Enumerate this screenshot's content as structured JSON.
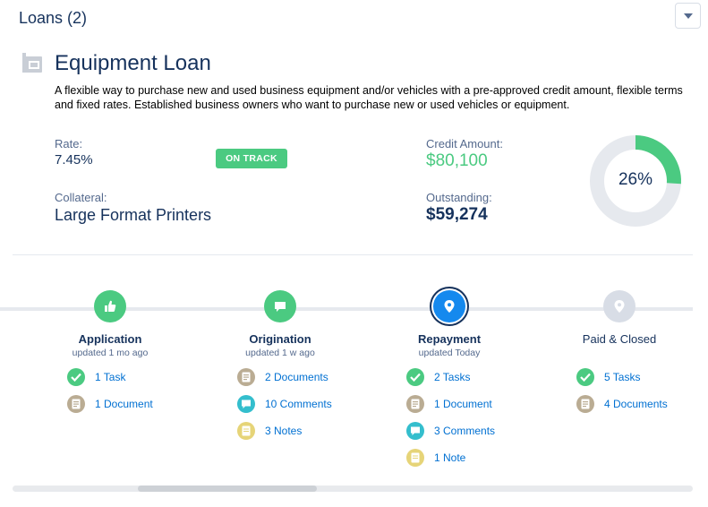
{
  "header": {
    "title": "Loans (2)",
    "menu_icon": "chevron-down-icon"
  },
  "loan": {
    "icon": "loan-building-icon",
    "title": "Equipment Loan",
    "description": "A flexible way to purchase new and used business equipment and/or vehicles with a pre-approved credit amount, flexible terms and fixed rates.  Established business owners who want to purchase new or used vehicles or equipment.",
    "rate_label": "Rate:",
    "rate_value": "7.45%",
    "status_badge": "ON TRACK",
    "collateral_label": "Collateral:",
    "collateral_value": "Large Format Printers",
    "credit_label": "Credit Amount:",
    "credit_value": "$80,100",
    "outstanding_label": "Outstanding:",
    "outstanding_value": "$59,274",
    "progress_text": "26%",
    "progress_fraction": 0.26
  },
  "stages": [
    {
      "name": "Application",
      "updated": "updated 1 mo ago",
      "state": "done",
      "icon": "thumbs-up-icon",
      "items": [
        {
          "icon": "check-icon",
          "label": "1 Task"
        },
        {
          "icon": "document-icon",
          "label": "1 Document"
        }
      ]
    },
    {
      "name": "Origination",
      "updated": "updated 1 w ago",
      "state": "done",
      "icon": "chat-bubble-icon",
      "items": [
        {
          "icon": "document-icon",
          "label": "2 Documents"
        },
        {
          "icon": "comment-icon",
          "label": "10 Comments"
        },
        {
          "icon": "note-icon",
          "label": "3 Notes"
        }
      ]
    },
    {
      "name": "Repayment",
      "updated": "updated Today",
      "state": "active",
      "icon": "location-pin-icon",
      "items": [
        {
          "icon": "check-icon",
          "label": "2 Tasks"
        },
        {
          "icon": "document-icon",
          "label": "1 Document"
        },
        {
          "icon": "comment-icon",
          "label": "3 Comments"
        },
        {
          "icon": "note-icon",
          "label": "1 Note"
        }
      ]
    },
    {
      "name": "Paid & Closed",
      "updated": "",
      "state": "pending",
      "icon": "location-pin-icon",
      "items": [
        {
          "icon": "check-icon",
          "label": "5 Tasks"
        },
        {
          "icon": "document-icon",
          "label": "4 Documents"
        }
      ]
    }
  ],
  "colors": {
    "accent_green": "#4bca81",
    "active_blue": "#1589ee",
    "link_blue": "#0070d2",
    "title_navy": "#16325c",
    "donut_track": "#e6e9ee"
  }
}
